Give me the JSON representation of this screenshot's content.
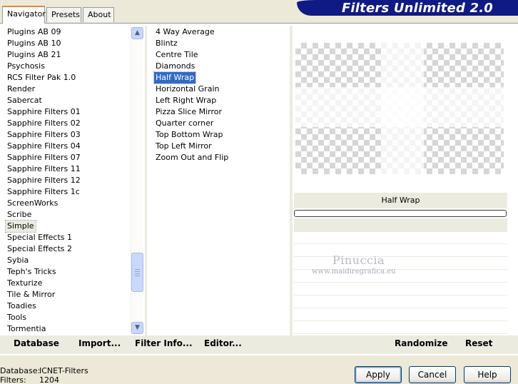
{
  "window": {
    "title": "Filters Unlimited 2.0"
  },
  "tabs": [
    {
      "label": "Navigator",
      "active": true
    },
    {
      "label": "Presets",
      "active": false
    },
    {
      "label": "About",
      "active": false
    }
  ],
  "categories": {
    "items": [
      "Plugins AB 09",
      "Plugins AB 10",
      "Plugins AB 21",
      "Psychosis",
      "RCS Filter Pak 1.0",
      "Render",
      "Sabercat",
      "Sapphire Filters 01",
      "Sapphire Filters 02",
      "Sapphire Filters 03",
      "Sapphire Filters 04",
      "Sapphire Filters 07",
      "Sapphire Filters 11",
      "Sapphire Filters 12",
      "Sapphire Filters 1c",
      "ScreenWorks",
      "Scribe",
      "Simple",
      "Special Effects 1",
      "Special Effects 2",
      "Sybia",
      "Teph's Tricks",
      "Texturize",
      "Tile & Mirror",
      "Toadies",
      "Tools",
      "Tormentia"
    ],
    "selected": "Simple"
  },
  "filters": {
    "items": [
      "4 Way Average",
      "Blintz",
      "Centre Tile",
      "Diamonds",
      "Half Wrap",
      "Horizontal Grain",
      "Left Right Wrap",
      "Pizza Slice Mirror",
      "Quarter corner",
      "Top Bottom Wrap",
      "Top Left Mirror",
      "Zoom Out and Flip"
    ],
    "selected": "Half Wrap"
  },
  "preview": {
    "filter_name": "Half Wrap",
    "watermark": "Pinuccia",
    "watermark_url": "www.maidiregrafica.eu"
  },
  "commands": {
    "database": "Database",
    "import": "Import...",
    "filter_info": "Filter Info...",
    "editor": "Editor...",
    "randomize": "Randomize",
    "reset": "Reset"
  },
  "status": {
    "database_label": "Database:",
    "database_value": "ICNET-Filters",
    "filters_label": "Filters:",
    "filters_value": "1204"
  },
  "buttons": {
    "apply": "Apply",
    "cancel": "Cancel",
    "help": "Help"
  },
  "colors": {
    "banner": "#0f1a85",
    "selection": "#316ac5",
    "panel": "#ecebe0",
    "active_tab_accent": "#e68b2c"
  }
}
